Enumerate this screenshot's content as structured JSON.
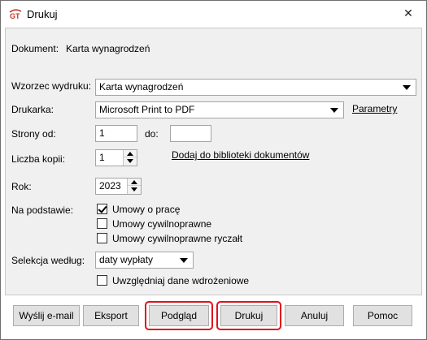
{
  "window": {
    "title": "Drukuj",
    "icon": "gt-logo-icon",
    "close_glyph": "✕"
  },
  "document": {
    "label": "Dokument:",
    "value": "Karta wynagrodzeń"
  },
  "template": {
    "label": "Wzorzec wydruku:",
    "value": "Karta wynagrodzeń"
  },
  "printer": {
    "label": "Drukarka:",
    "value": "Microsoft Print to PDF",
    "params_link": "Parametry"
  },
  "pages": {
    "from_label": "Strony od:",
    "from_value": "1",
    "to_label": "do:",
    "to_value": ""
  },
  "copies": {
    "label": "Liczba kopii:",
    "value": "1",
    "add_link": "Dodaj do biblioteki dokumentów"
  },
  "year": {
    "label": "Rok:",
    "value": "2023"
  },
  "basis": {
    "label": "Na podstawie:",
    "options": [
      {
        "label": "Umowy o pracę",
        "checked": true
      },
      {
        "label": "Umowy cywilnoprawne",
        "checked": false
      },
      {
        "label": "Umowy cywilnoprawne ryczałt",
        "checked": false
      }
    ]
  },
  "selection": {
    "label": "Selekcja według:",
    "value": "daty wypłaty",
    "implementation_label": "Uwzględniaj dane wdrożeniowe",
    "implementation_checked": false
  },
  "buttons": {
    "send_email": "Wyślij e-mail",
    "export": "Eksport",
    "preview": "Podgląd",
    "print": "Drukuj",
    "cancel": "Anuluj",
    "help": "Pomoc"
  },
  "colors": {
    "highlight": "#e0101a",
    "panel_bg": "#f0f0f0"
  }
}
